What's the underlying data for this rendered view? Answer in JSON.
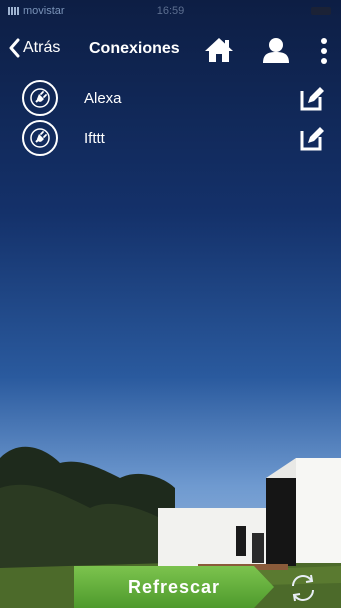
{
  "status_bar": {
    "carrier": "movistar",
    "time": "16:59"
  },
  "header": {
    "back_label": "Atrás",
    "title": "Conexiones"
  },
  "connections": [
    {
      "name": "Alexa"
    },
    {
      "name": "Ifttt"
    }
  ],
  "footer": {
    "refresh_label": "Refrescar"
  },
  "colors": {
    "accent_green": "#5fa835",
    "background_sky": "#14316a"
  }
}
